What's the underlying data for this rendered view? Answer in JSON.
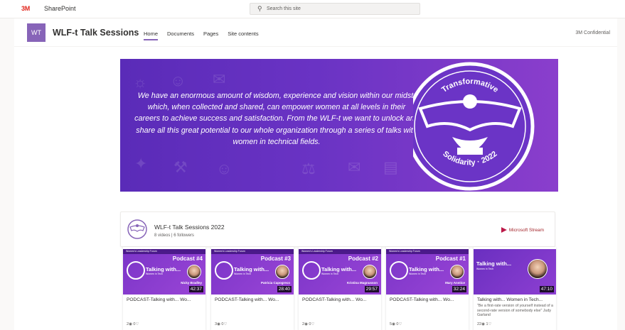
{
  "suite_bar": {
    "brand": "3M",
    "app_name": "SharePoint",
    "search_placeholder": "Search this site"
  },
  "site": {
    "logo_initials": "WT",
    "title": "WLF-t Talk Sessions",
    "nav": [
      "Home",
      "Documents",
      "Pages",
      "Site contents"
    ],
    "active_nav": "Home",
    "classification": "3M Confidential"
  },
  "banner": {
    "text": "We have an enormous amount of wisdom, experience and vision within our midst, which, when collected and shared, can empower women at all levels in their careers to achieve success and satisfaction. From the WLF-t we want to unlock and share all this great potential to our whole organization through a series of talks with women in technical fields.",
    "seal_top": "Transformative",
    "seal_bottom": "Solidarity · 2022"
  },
  "channel": {
    "title": "WLF-t Talk Sessions 2022",
    "subtitle": "8 videos | 6 followers",
    "provider": "Microsoft Stream"
  },
  "videos": [
    {
      "badge": "Podcast #4",
      "person": "Nicky Bradley",
      "duration": "42:37",
      "title": "PODCAST-Talking with... Wo...",
      "views": "2",
      "likes": "0"
    },
    {
      "badge": "Podcast #3",
      "person": "Patricia Capogreco",
      "duration": "28:40",
      "title": "PODCAST-Talking with... Wo...",
      "views": "3",
      "likes": "0"
    },
    {
      "badge": "Podcast #2",
      "person": "Kristina Magnusson",
      "duration": "29:57",
      "title": "PODCAST-Talking with... Wo...",
      "views": "2",
      "likes": "0"
    },
    {
      "badge": "Podcast #1",
      "person": "Mary Anstice",
      "duration": "32:24",
      "title": "PODCAST-Talking with... Wo...",
      "views": "5",
      "likes": "0"
    },
    {
      "badge": "",
      "person": "",
      "duration": "47:10",
      "title": "Talking with... Women in Tech...",
      "description": "\"Be a first-rate version of yourself instead of a second-rate version of somebody else\" Judy Garland",
      "views": "22",
      "likes": "1"
    }
  ],
  "thumbnail_header": "Women's Leadership Forum",
  "thumbnail_talk": "Talking with...",
  "thumbnail_talk_sub": "Women in Tech",
  "colors": {
    "brand_purple": "#8764b8",
    "banner_purple": "#6a33c4",
    "stream_red": "#bc1948"
  }
}
